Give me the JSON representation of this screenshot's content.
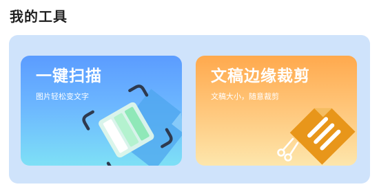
{
  "section": {
    "title": "我的工具"
  },
  "cards": [
    {
      "title": "一键扫描",
      "subtitle": "图片轻松变文字",
      "icon": "scan-frame-icon",
      "gradient": [
        "#5b9cff",
        "#7ee0f6"
      ]
    },
    {
      "title": "文稿边缘裁剪",
      "subtitle": "文稿大小，随意裁剪",
      "icon": "scissors-crop-icon",
      "gradient": [
        "#ffa94d",
        "#fde6ac"
      ]
    }
  ],
  "colors": {
    "panel_bg": "#cfe3fb",
    "title_text": "#1f1f1f",
    "crop_accent": "#e8961a",
    "scan_frame": "#2e3a4f",
    "scan_inner": "#a6f0c8"
  }
}
